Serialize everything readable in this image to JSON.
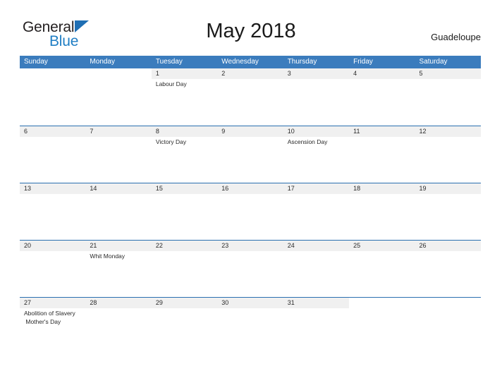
{
  "brand": {
    "line1": "General",
    "line2": "Blue",
    "triangle_color": "#1f6fb4",
    "line2_color": "#1f7ec4"
  },
  "header": {
    "title": "May 2018",
    "location": "Guadeloupe"
  },
  "theme": {
    "header_blue": "#3b7cbd",
    "row_divider_blue": "#2a6fb0",
    "date_band_gray": "#f0f0f0"
  },
  "weekdays": [
    "Sunday",
    "Monday",
    "Tuesday",
    "Wednesday",
    "Thursday",
    "Friday",
    "Saturday"
  ],
  "weeks": [
    [
      {
        "date": "",
        "events": []
      },
      {
        "date": "",
        "events": []
      },
      {
        "date": "1",
        "events": [
          "Labour Day"
        ]
      },
      {
        "date": "2",
        "events": []
      },
      {
        "date": "3",
        "events": []
      },
      {
        "date": "4",
        "events": []
      },
      {
        "date": "5",
        "events": []
      }
    ],
    [
      {
        "date": "6",
        "events": []
      },
      {
        "date": "7",
        "events": []
      },
      {
        "date": "8",
        "events": [
          "Victory Day"
        ]
      },
      {
        "date": "9",
        "events": []
      },
      {
        "date": "10",
        "events": [
          "Ascension Day"
        ]
      },
      {
        "date": "11",
        "events": []
      },
      {
        "date": "12",
        "events": []
      }
    ],
    [
      {
        "date": "13",
        "events": []
      },
      {
        "date": "14",
        "events": []
      },
      {
        "date": "15",
        "events": []
      },
      {
        "date": "16",
        "events": []
      },
      {
        "date": "17",
        "events": []
      },
      {
        "date": "18",
        "events": []
      },
      {
        "date": "19",
        "events": []
      }
    ],
    [
      {
        "date": "20",
        "events": []
      },
      {
        "date": "21",
        "events": [
          "Whit Monday"
        ]
      },
      {
        "date": "22",
        "events": []
      },
      {
        "date": "23",
        "events": []
      },
      {
        "date": "24",
        "events": []
      },
      {
        "date": "25",
        "events": []
      },
      {
        "date": "26",
        "events": []
      }
    ],
    [
      {
        "date": "27",
        "events": [
          "Abolition of Slavery",
          " Mother's Day"
        ]
      },
      {
        "date": "28",
        "events": []
      },
      {
        "date": "29",
        "events": []
      },
      {
        "date": "30",
        "events": []
      },
      {
        "date": "31",
        "events": []
      },
      {
        "date": "",
        "events": []
      },
      {
        "date": "",
        "events": []
      }
    ]
  ]
}
